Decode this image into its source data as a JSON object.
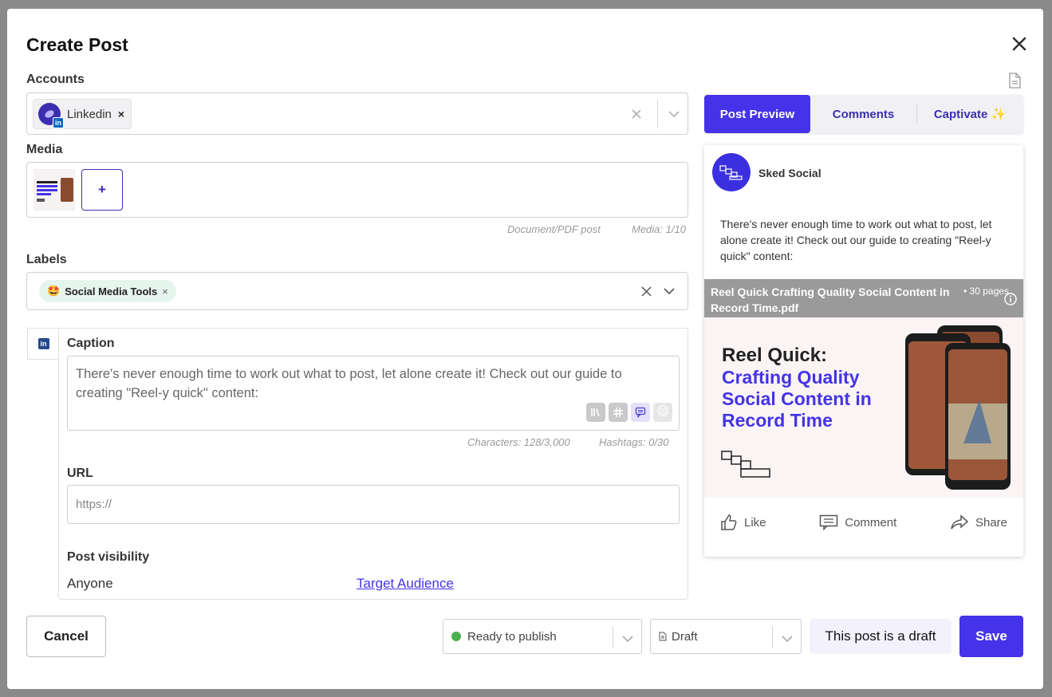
{
  "modal": {
    "title": "Create Post"
  },
  "accounts": {
    "label": "Accounts",
    "selected": [
      {
        "name": "Linkedin",
        "badge": "in"
      }
    ]
  },
  "media": {
    "label": "Media",
    "add_label": "+",
    "post_type": "Document/PDF post",
    "count": "Media: 1/10"
  },
  "labels": {
    "label": "Labels",
    "selected": [
      {
        "emoji": "🤩",
        "name": "Social Media Tools"
      }
    ]
  },
  "caption": {
    "label": "Caption",
    "text": "There's never enough time to work out what to post, let alone create it! Check out our guide to creating \"Reel-y quick\" content:",
    "characters": "Characters: 128/3,000",
    "hashtags": "Hashtags: 0/30"
  },
  "url": {
    "label": "URL",
    "placeholder": "https://"
  },
  "visibility": {
    "label": "Post visibility",
    "value": "Anyone",
    "link": "Target Audience"
  },
  "preview": {
    "tabs": [
      "Post Preview",
      "Comments",
      "Captivate ✨"
    ],
    "active_tab": 0,
    "account_name": "Sked Social",
    "text": "There's never enough time to work out what to post, let alone create it! Check out our guide to creating \"Reel-y quick\" content:",
    "pdf_title": "Reel Quick Crafting Quality Social Content in Record Time.pdf",
    "pdf_pages": "• 30 pages",
    "doc_heading": "Reel Quick:",
    "doc_subheading": "Crafting Quality Social Content in Record Time",
    "actions": [
      "Like",
      "Comment",
      "Share"
    ]
  },
  "footer": {
    "cancel": "Cancel",
    "status": "Ready to publish",
    "status_color": "#4caf50",
    "draft": "Draft",
    "draft_note": "This post is a draft",
    "save": "Save"
  },
  "colors": {
    "accent": "#4433e8"
  }
}
